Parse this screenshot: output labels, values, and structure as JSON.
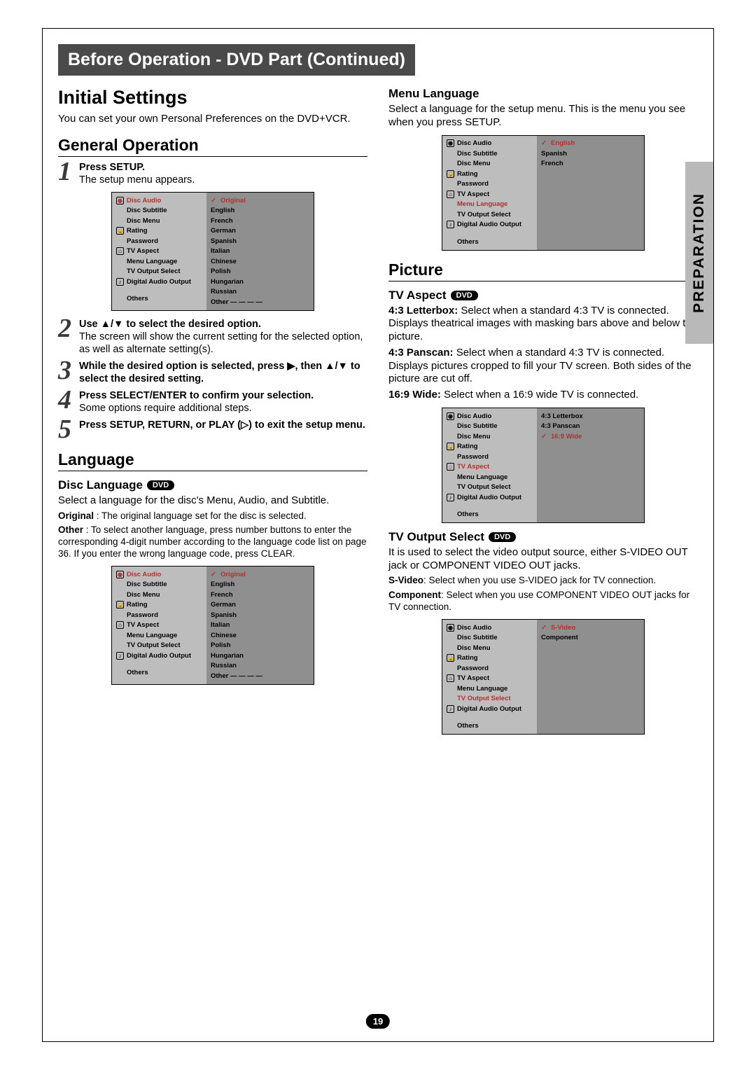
{
  "titleBar": "Before Operation - DVD Part (Continued)",
  "sideTab": "PREPARATION",
  "pageNumber": "19",
  "left": {
    "h1": "Initial Settings",
    "intro": "You can set your own Personal Preferences on the DVD+VCR.",
    "h2a": "General Operation",
    "step1b": "Press SETUP.",
    "step1t": "The setup menu appears.",
    "step2b": "Use ▲/▼ to select the desired option.",
    "step2t": "The screen will show the current setting for the selected option, as well as alternate setting(s).",
    "step3b": "While the desired option is selected, press ▶, then ▲/▼ to select the desired setting.",
    "step4b": "Press SELECT/ENTER to confirm your selection.",
    "step4t": "Some options require additional steps.",
    "step5b": "Press SETUP, RETURN, or PLAY (▷) to exit the setup menu.",
    "h2b": "Language",
    "sub1": "Disc Language",
    "disc1": "Select a language for the disc's Menu, Audio, and Subtitle.",
    "disc2a": "Original",
    "disc2b": " : The original language set for the disc is selected.",
    "disc3a": "Other",
    "disc3b": " : To select another language, press number buttons to enter the corresponding 4-digit number according to the language code list on page 36. If you enter the wrong language code, press CLEAR."
  },
  "right": {
    "sub1": "Menu Language",
    "menu1": "Select a language for the setup menu. This is the menu you see when you press SETUP.",
    "h2a": "Picture",
    "sub2": "TV Aspect",
    "asp1a": "4:3 Letterbox:",
    "asp1b": " Select when a standard 4:3 TV is connected. Displays theatrical images with masking bars above and below the picture.",
    "asp2a": "4:3 Panscan:",
    "asp2b": " Select when a standard 4:3 TV is connected. Displays pictures cropped to fill your TV screen. Both sides of the picture are cut off.",
    "asp3a": "16:9 Wide:",
    "asp3b": " Select when a 16:9 wide TV is connected.",
    "sub3": "TV Output Select",
    "out1": "It is used to select the video output source, either S-VIDEO OUT jack or COMPONENT VIDEO OUT jacks.",
    "out2a": "S-Video",
    "out2b": ": Select when you use S-VIDEO jack for TV connection.",
    "out3a": "Component",
    "out3b": ": Select when you use COMPONENT VIDEO OUT jacks for TV connection."
  },
  "dvdLabel": "DVD",
  "menuItems": [
    "Disc Audio",
    "Disc Subtitle",
    "Disc Menu",
    "Rating",
    "Password",
    "TV Aspect",
    "Menu Language",
    "TV Output Select",
    "Digital Audio Output",
    "Others"
  ],
  "langOpts": [
    "Original",
    "English",
    "French",
    "German",
    "Spanish",
    "Italian",
    "Chinese",
    "Polish",
    "Hungarian",
    "Russian",
    "Other  — — — —"
  ],
  "menuLangOpts": [
    "English",
    "Spanish",
    "French"
  ],
  "aspectOpts": [
    "4:3 Letterbox",
    "4:3 Panscan",
    "16:9 Wide"
  ],
  "outputOpts": [
    "S-Video",
    "Component"
  ]
}
